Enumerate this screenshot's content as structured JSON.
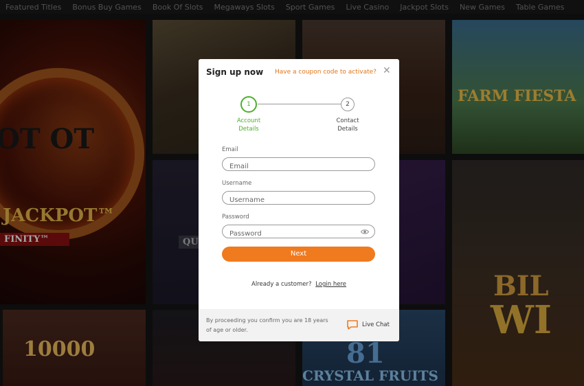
{
  "nav": {
    "items": [
      "Featured Titles",
      "Bonus Buy Games",
      "Book Of Slots",
      "Megaways Slots",
      "Sport Games",
      "Live Casino",
      "Jackpot Slots",
      "New Games",
      "Table Games"
    ]
  },
  "tiles": {
    "hot": "OT OT",
    "jackpot": "JACKPOT™",
    "infinity": "FINITY™",
    "farm": "FARM FIESTA",
    "bil": "BIL",
    "w": "WI",
    "tenk": "10000",
    "crystal": "CRYSTAL FRUITS",
    "eightyone": "81",
    "quin": "QUI"
  },
  "modal": {
    "title": "Sign up now",
    "coupon_link": "Have a coupon code to activate?",
    "close_symbol": "✕",
    "steps": [
      {
        "number": "1",
        "label_line1": "Account",
        "label_line2": "Details",
        "state": "active"
      },
      {
        "number": "2",
        "label_line1": "Contact",
        "label_line2": "Details",
        "state": "inactive"
      }
    ],
    "fields": {
      "email": {
        "label": "Email",
        "placeholder": "Email",
        "value": ""
      },
      "username": {
        "label": "Username",
        "placeholder": "Username",
        "value": ""
      },
      "password": {
        "label": "Password",
        "placeholder": "Password",
        "value": ""
      }
    },
    "next_label": "Next",
    "already_text": "Already a customer?",
    "login_link": "Login here",
    "footer_text": "By proceeding you confirm you are 18 years of age or older.",
    "live_chat_label": "Live Chat"
  },
  "colors": {
    "accent": "#f07a1e",
    "step_active": "#4caf2a",
    "coupon": "#e07418"
  },
  "icons": [
    "close-icon",
    "eye-icon",
    "chat-icon"
  ]
}
